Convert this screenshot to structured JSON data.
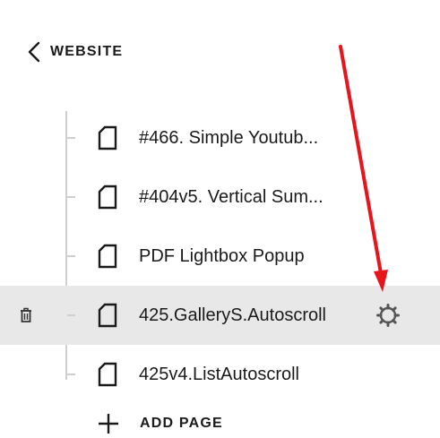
{
  "header": {
    "back_label": "WEBSITE",
    "back_icon": "chevron-left-icon"
  },
  "pages": [
    {
      "label": "#466. Simple Youtub...",
      "icon": "page-icon",
      "selected": false
    },
    {
      "label": "#404v5. Vertical Sum...",
      "icon": "page-icon",
      "selected": false
    },
    {
      "label": "PDF Lightbox Popup",
      "icon": "page-icon",
      "selected": false
    },
    {
      "label": "425.GalleryS.Autoscroll",
      "icon": "page-icon",
      "selected": true
    },
    {
      "label": "425v4.ListAutoscroll",
      "icon": "page-icon",
      "selected": false
    }
  ],
  "selected_actions": {
    "delete_icon": "trash-icon",
    "settings_icon": "gear-icon"
  },
  "footer": {
    "add_label": "ADD PAGE",
    "add_icon": "plus-icon"
  },
  "annotation": {
    "arrow_color": "#e8141c"
  },
  "colors": {
    "selected_row_bg": "#e8e8e8",
    "tree_line": "#cfcfcf",
    "icon_gray": "#555555"
  }
}
